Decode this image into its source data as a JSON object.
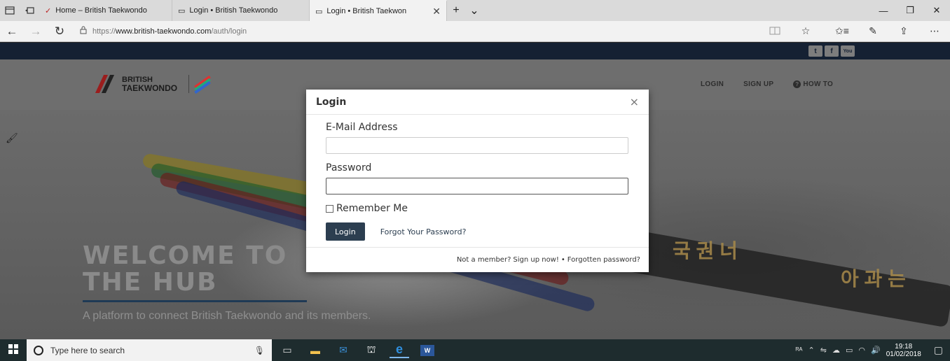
{
  "browser": {
    "tabs": [
      {
        "title": "Home – British Taekwondo",
        "active": false
      },
      {
        "title": "Login • British Taekwondo",
        "active": false
      },
      {
        "title": "Login • British Taekwon",
        "active": true
      }
    ],
    "close_glyph": "✕",
    "new_tab_glyph": "+",
    "tab_menu_glyph": "⌄",
    "window": {
      "minimize": "—",
      "restore": "❐",
      "close": "✕"
    },
    "nav": {
      "back": "←",
      "forward": "→",
      "refresh": "↻"
    },
    "url": {
      "scheme": "https://",
      "host": "www.british-taekwondo.com",
      "path": "/auth/login"
    },
    "toolbar_icons": [
      "reading-view-icon",
      "favorite-star-icon",
      "favorites-hub-icon",
      "pen-icon",
      "share-icon",
      "more-icon"
    ]
  },
  "site": {
    "social": [
      "t",
      "f",
      "You"
    ],
    "logo": {
      "line1": "BRITISH",
      "line2": "TAEKWONDO"
    },
    "nav": {
      "login": "LOGIN",
      "signup": "SIGN UP",
      "howto": "HOW TO"
    },
    "hero": {
      "title_line1": "WELCOME TO",
      "title_line2": "THE HUB",
      "subtitle": "A platform to connect British Taekwondo and its members."
    }
  },
  "modal": {
    "title": "Login",
    "close": "×",
    "email_label": "E-Mail Address",
    "email_value": "",
    "password_label": "Password",
    "password_value": "",
    "remember_label": "Remember Me",
    "login_button": "Login",
    "forgot_link": "Forgot Your Password?",
    "footer": {
      "prefix": "Not a member?",
      "signup": "Sign up now!",
      "separator": "•",
      "forgotten": "Forgotten password?"
    }
  },
  "taskbar": {
    "search_placeholder": "Type here to search",
    "time": "19:18",
    "date": "01/02/2018"
  },
  "colors": {
    "navbar_dark": "#152133",
    "primary_button": "#2c3e50",
    "taskbar": "#1e2c2e"
  }
}
